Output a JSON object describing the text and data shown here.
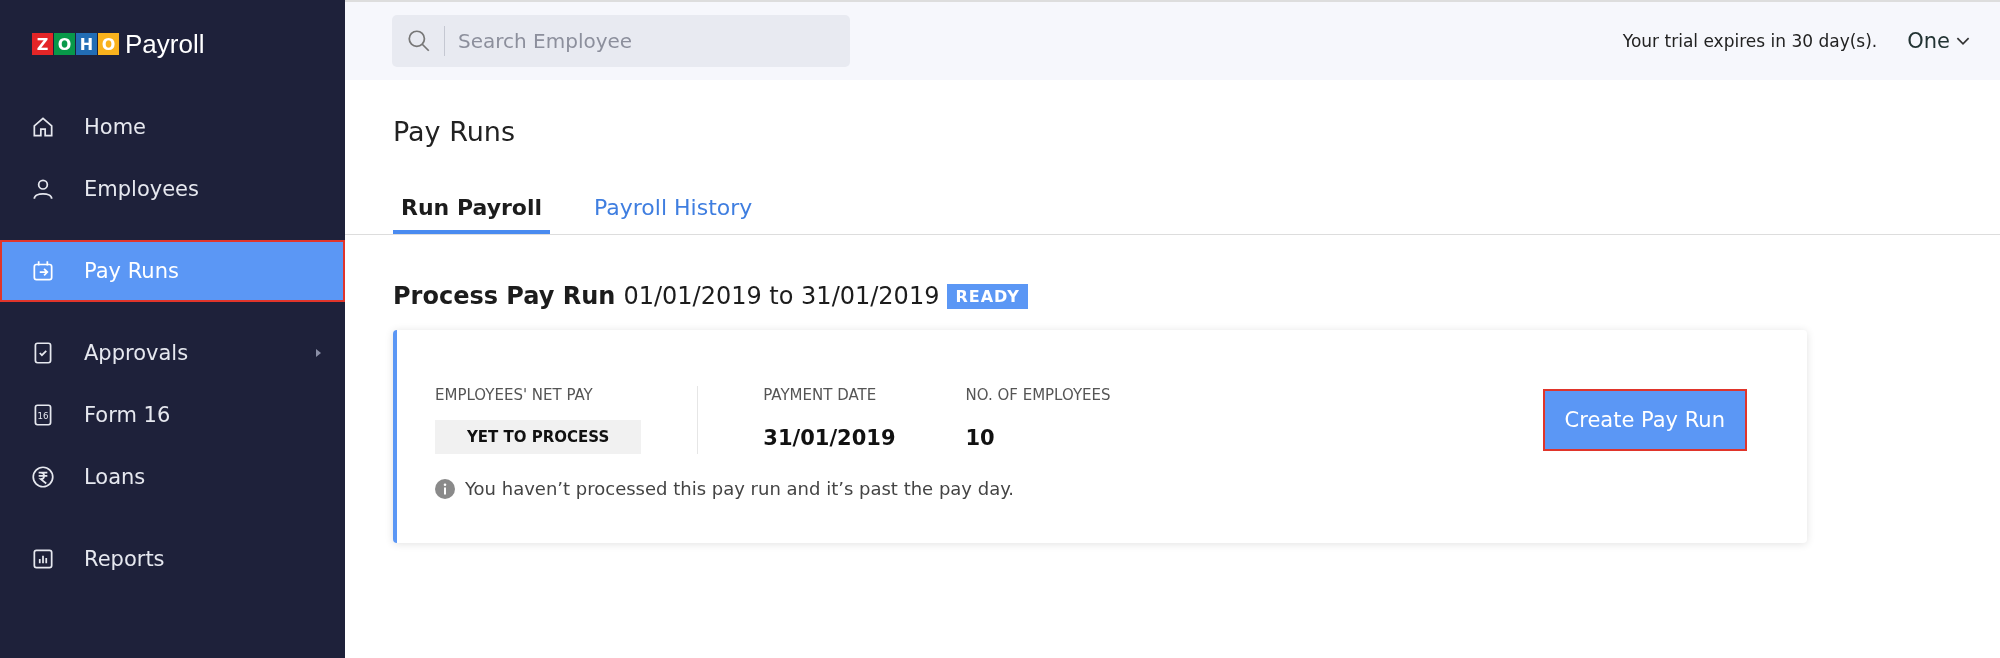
{
  "logo": {
    "letters": [
      {
        "char": "Z",
        "color": "#e42527"
      },
      {
        "char": "O",
        "color": "#089949"
      },
      {
        "char": "H",
        "color": "#226db4"
      },
      {
        "char": "O",
        "color": "#f9b21d"
      }
    ],
    "product": "Payroll"
  },
  "sidebar": {
    "items": [
      {
        "label": "Home",
        "selected": false,
        "submenu": false
      },
      {
        "label": "Employees",
        "selected": false,
        "submenu": false
      },
      {
        "label": "Pay Runs",
        "selected": true,
        "submenu": false
      },
      {
        "label": "Approvals",
        "selected": false,
        "submenu": true
      },
      {
        "label": "Form 16",
        "selected": false,
        "submenu": false,
        "icon_text": "16"
      },
      {
        "label": "Loans",
        "selected": false,
        "submenu": false
      },
      {
        "label": "Reports",
        "selected": false,
        "submenu": false
      }
    ]
  },
  "header": {
    "search": {
      "placeholder": "Search Employee"
    },
    "trial_notice": "Your trial expires in 30 day(s).",
    "org": "One"
  },
  "page": {
    "title": "Pay Runs",
    "tabs": [
      {
        "label": "Run Payroll",
        "selected": true
      },
      {
        "label": "Payroll History",
        "selected": false
      }
    ],
    "heading": {
      "title": "Process Pay Run",
      "period": "01/01/2019 to 31/01/2019",
      "status": "READY"
    },
    "card": {
      "stats": [
        {
          "label": "EMPLOYEES' NET PAY",
          "value": "YET TO PROCESS",
          "kind": "badge"
        },
        {
          "label": "PAYMENT DATE",
          "value": "31/01/2019",
          "kind": "plain"
        },
        {
          "label": "NO. OF EMPLOYEES",
          "value": "10",
          "kind": "plain"
        }
      ],
      "button": "Create Pay Run",
      "note": "You haven’t processed this pay run and it’s past the pay day."
    }
  }
}
